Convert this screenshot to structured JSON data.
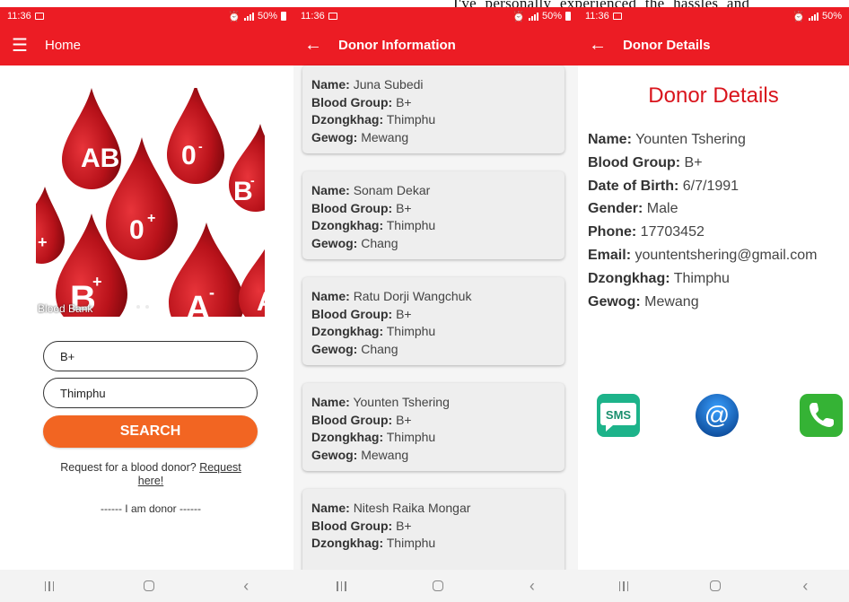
{
  "top_text": "I've personally experienced the hassles and",
  "status": {
    "time": "11:36",
    "battery": "50%"
  },
  "home": {
    "title": "Home",
    "banner": {
      "caption": "Blood Bank",
      "drop_labels": [
        "AB",
        "O",
        "B",
        "O",
        "B",
        "A"
      ]
    },
    "blood_group_value": "B+",
    "dzongkhag_value": "Thimphu",
    "search_label": "SEARCH",
    "request_prefix": "Request for a blood donor?",
    "request_link": "Request here!",
    "donor_line": "------ I am donor ------"
  },
  "donor_info": {
    "title": "Donor Information",
    "field_labels": {
      "name": "Name:",
      "blood_group": "Blood Group:",
      "dzongkhag": "Dzongkhag:",
      "gewog": "Gewog:"
    },
    "donors": [
      {
        "name": "Juna Subedi",
        "blood_group": "B+",
        "dzongkhag": "Thimphu",
        "gewog": "Mewang"
      },
      {
        "name": "Sonam Dekar",
        "blood_group": "B+",
        "dzongkhag": "Thimphu",
        "gewog": "Chang"
      },
      {
        "name": "Ratu Dorji Wangchuk",
        "blood_group": "B+",
        "dzongkhag": "Thimphu",
        "gewog": "Chang"
      },
      {
        "name": "Younten Tshering",
        "blood_group": "B+",
        "dzongkhag": "Thimphu",
        "gewog": "Mewang"
      },
      {
        "name": "Nitesh Raika Mongar",
        "blood_group": "B+",
        "dzongkhag": "Thimphu",
        "gewog": ""
      }
    ]
  },
  "donor_details": {
    "title": "Donor Details",
    "heading": "Donor Details",
    "fields": [
      {
        "label": "Name:",
        "value": "Younten Tshering"
      },
      {
        "label": "Blood Group:",
        "value": "B+"
      },
      {
        "label": "Date of Birth:",
        "value": "6/7/1991"
      },
      {
        "label": "Gender:",
        "value": "Male"
      },
      {
        "label": "Phone:",
        "value": "17703452"
      },
      {
        "label": "Email:",
        "value": "yountentshering@gmail.com"
      },
      {
        "label": "Dzongkhag:",
        "value": "Thimphu"
      },
      {
        "label": "Gewog:",
        "value": "Mewang"
      }
    ],
    "sms_label": "SMS",
    "email_symbol": "@"
  },
  "colors": {
    "primary": "#ec1c24",
    "search_button": "#f26522",
    "heading_red": "#d9141c"
  },
  "icons": [
    "hamburger-menu-icon",
    "back-arrow-icon",
    "sms-icon",
    "email-icon",
    "phone-icon"
  ]
}
